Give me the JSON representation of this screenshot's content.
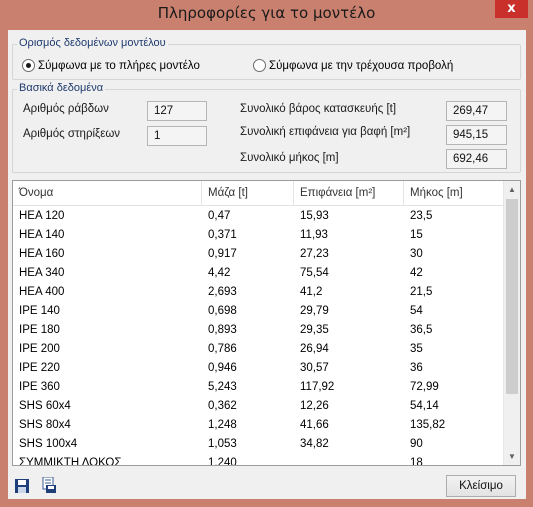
{
  "window": {
    "title": "Πληροφορίες για το μοντέλο",
    "close_glyph": "x"
  },
  "model_group": {
    "label": "Ορισμός δεδομένων μοντέλου",
    "option_full": "Σύμφωνα με το πλήρες μοντέλο",
    "option_current": "Σύμφωνα με την τρέχουσα προβολή",
    "selected": "full"
  },
  "basic_group": {
    "label": "Βασικά δεδομένα",
    "bars_label": "Αριθμός ράβδων",
    "bars_value": "127",
    "supports_label": "Αριθμός στηρίξεων",
    "supports_value": "1",
    "weight_label": "Συνολικό βάρος κατασκευής [t]",
    "weight_value": "269,47",
    "area_label": "Συνολική επιφάνεια για βαφή [m²]",
    "area_value": "945,15",
    "length_label": "Συνολικό μήκος [m]",
    "length_value": "692,46"
  },
  "table": {
    "headers": [
      "Όνομα",
      "Μάζα [t]",
      "Επιφάνεια [m²]",
      "Μήκος [m]"
    ],
    "rows": [
      [
        "HEA 120",
        "0,47",
        "15,93",
        "23,5"
      ],
      [
        "HEA 140",
        "0,371",
        "11,93",
        "15"
      ],
      [
        "HEA 160",
        "0,917",
        "27,23",
        "30"
      ],
      [
        "HEA 340",
        "4,42",
        "75,54",
        "42"
      ],
      [
        "HEA 400",
        "2,693",
        "41,2",
        "21,5"
      ],
      [
        "IPE 140",
        "0,698",
        "29,79",
        "54"
      ],
      [
        "IPE 180",
        "0,893",
        "29,35",
        "36,5"
      ],
      [
        "IPE 200",
        "0,786",
        "26,94",
        "35"
      ],
      [
        "IPE 220",
        "0,946",
        "30,57",
        "36"
      ],
      [
        "IPE 360",
        "5,243",
        "117,92",
        "72,99"
      ],
      [
        "SHS 60x4",
        "0,362",
        "12,26",
        "54,14"
      ],
      [
        "SHS 80x4",
        "1,248",
        "41,66",
        "135,82"
      ],
      [
        "SHS 100x4",
        "1,053",
        "34,82",
        "90"
      ],
      [
        "ΣΥΜΜΙΚΤΗ ΔΟΚΟΣ",
        "1,240",
        "",
        "18"
      ]
    ]
  },
  "footer": {
    "close_button": "Κλείσιμο"
  },
  "colors": {
    "titlebar": "#c9806e",
    "close": "#c9302c",
    "group_label": "#1e3a6e"
  }
}
